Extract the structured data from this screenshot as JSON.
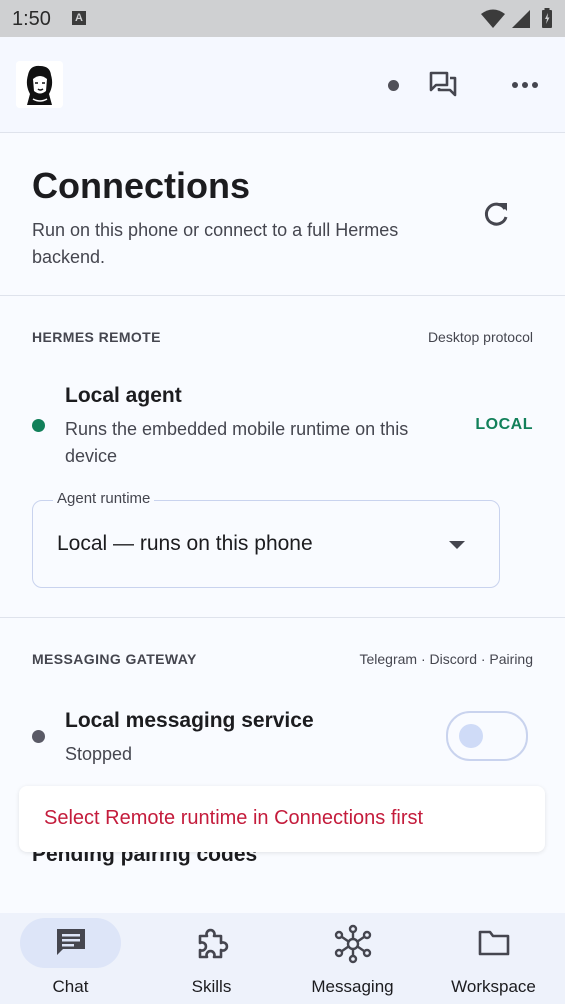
{
  "status_bar": {
    "time": "1:50",
    "notification_letter": "A"
  },
  "app_bar": {
    "icons": [
      "avatar",
      "status-dot",
      "conversations-icon",
      "more-icon"
    ]
  },
  "header": {
    "title": "Connections",
    "subtitle": "Run on this phone or connect to a full Hermes backend."
  },
  "hermes_remote": {
    "label": "HERMES REMOTE",
    "meta": "Desktop protocol",
    "agent": {
      "title": "Local agent",
      "description": "Runs the embedded mobile runtime on this device",
      "badge": "LOCAL",
      "status_color": "#12805a"
    },
    "runtime_field": {
      "label": "Agent runtime",
      "value": "Local — runs on this phone"
    }
  },
  "messaging_gateway": {
    "label": "MESSAGING GATEWAY",
    "meta": "Telegram · Discord · Pairing",
    "service": {
      "title": "Local messaging service",
      "status": "Stopped",
      "status_color": "#5a5a66",
      "enabled": false
    },
    "pending_title": "Pending pairing codes"
  },
  "toast": {
    "message": "Select Remote runtime in Connections first",
    "color": "#c41c3c"
  },
  "bottom_nav": {
    "items": [
      {
        "label": "Chat",
        "icon": "chat-icon",
        "selected": true
      },
      {
        "label": "Skills",
        "icon": "puzzle-icon",
        "selected": false
      },
      {
        "label": "Messaging",
        "icon": "hub-icon",
        "selected": false
      },
      {
        "label": "Workspace",
        "icon": "folder-icon",
        "selected": false
      }
    ]
  }
}
